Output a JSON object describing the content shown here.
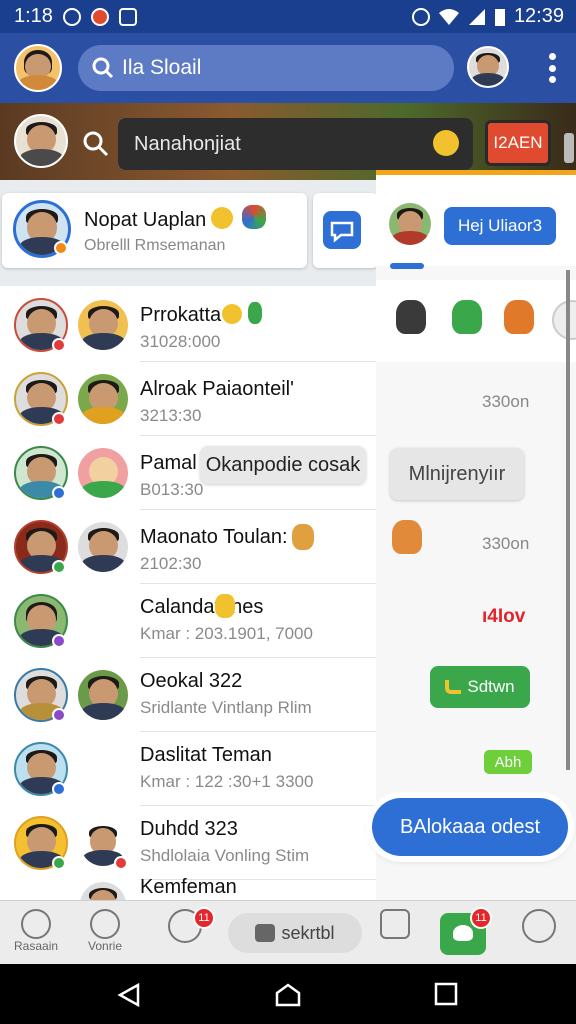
{
  "status_bar": {
    "time_left": "1:18",
    "time_right": "12:39"
  },
  "app_bar": {
    "search_text": "Ila Sloail"
  },
  "banner": {
    "search_text": "Nanahonjiat",
    "red_button": "I2AEN"
  },
  "featured": {
    "name": "Nopat Uaplan",
    "subtitle": "Obrelll Rmsemanan",
    "right_button": "Hej Uliaor3"
  },
  "contacts": [
    {
      "name": "Prrokatta",
      "sub": "31028:000",
      "ring": "#c94b3a",
      "dot": "#e23b3b"
    },
    {
      "name": "Alroak Paiaonteil'",
      "sub": "3213:30",
      "ring": "#c9a23a",
      "dot": "#e23b3b"
    },
    {
      "name": "Pamal",
      "sub": "B013:30",
      "ring": "#3a8a4a",
      "dot": "#2e6fd6"
    },
    {
      "name": "Maonato Toulan:",
      "sub": "2102:30",
      "ring": "#b2402c",
      "dot": "#3aa84a"
    },
    {
      "name": "Calandatones",
      "sub": "Kmar : 203.1901, 7000",
      "ring": "#3a8a4a",
      "dot": "#8a4ac9"
    },
    {
      "name": "Oeokal 322",
      "sub": "Sridlante Vintlanp Rlim",
      "ring": "#3a7aa8",
      "dot": "#8a4ac9"
    },
    {
      "name": "Daslitat Teman",
      "sub": "Kmar : 122 :30+1 3300",
      "ring": "#3a8aa8",
      "dot": "#2e6fd6"
    },
    {
      "name": "Duhdd 323",
      "sub": "Shdlolaia Vonling Stim",
      "ring": "#e0a020",
      "dot": "#3aa84a"
    },
    {
      "name": "Kemfeman",
      "sub": "",
      "ring": "#888888",
      "dot": "#888888"
    }
  ],
  "tooltip": "Okanpodie cosak",
  "right_panel": {
    "t1": "330on",
    "bubble": "Mlnijrenyiır",
    "t2": "330on",
    "red_text": "ı4Iov",
    "green_bubble": "Sdtwn",
    "green_chip": "Abh",
    "fab": "BAlokaaa odest"
  },
  "bottom_nav": {
    "item1": "Rasaain",
    "item2": "Vonrie",
    "badge1": "11",
    "pill": "sekrtbl",
    "badge2": "11"
  },
  "colors": {
    "appbar": "#2a4fa3",
    "accent": "#2e6fd6",
    "green": "#3aa84a",
    "red": "#e04a2e"
  }
}
